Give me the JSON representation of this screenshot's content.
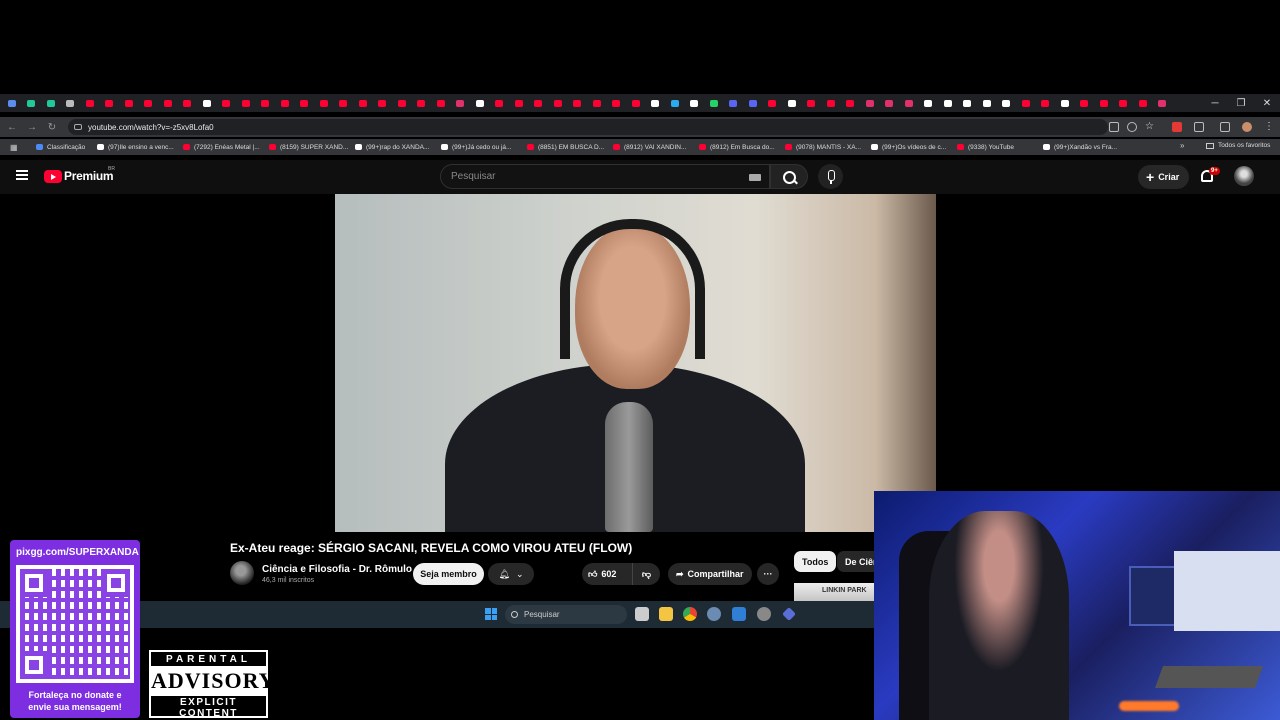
{
  "browser": {
    "url": "youtube.com/watch?v=-z5xv8Lofa0",
    "all_bookmarks_label": "Todos os favoritos",
    "bookmarks": [
      {
        "label": "Classificação",
        "color": "#4c8bf5"
      },
      {
        "label": "(97)Ile ensino a venc...",
        "color": "#ffffff"
      },
      {
        "label": "(7292) Enéas Metal |...",
        "color": "#ff0033"
      },
      {
        "label": "(8159) SUPER XAND...",
        "color": "#ff0033"
      },
      {
        "label": "(99+)rap do XANDÃ...",
        "color": "#ffffff"
      },
      {
        "label": "(99+)Já cedo ou já...",
        "color": "#ffffff"
      },
      {
        "label": "(8851) EM BUSCA D...",
        "color": "#ff0033"
      },
      {
        "label": "(8912) VAI XANDIN...",
        "color": "#ff0033"
      },
      {
        "label": "(8912) Em Busca do...",
        "color": "#ff0033"
      },
      {
        "label": "(9078) MANTIS - XA...",
        "color": "#ff0033"
      },
      {
        "label": "(99+)Os vídeos de c...",
        "color": "#ffffff"
      },
      {
        "label": "(9338) YouTube",
        "color": "#ff0033"
      },
      {
        "label": "(99+)Xandão vs Fra...",
        "color": "#ffffff"
      }
    ],
    "tab_colors": [
      "#5b8def",
      "#20c997",
      "#20c997",
      "#bbbbbb",
      "#ff0033",
      "#ff0033",
      "#ff0033",
      "#ff0033",
      "#ff0033",
      "#ff0033",
      "#ffffff",
      "#ff0033",
      "#ff0033",
      "#ff0033",
      "#ff0033",
      "#ff0033",
      "#ff0033",
      "#ff0033",
      "#ff0033",
      "#ff0033",
      "#ff0033",
      "#ff0033",
      "#ff0033",
      "#e1306c",
      "#ffffff",
      "#ff0033",
      "#ff0033",
      "#ff0033",
      "#ff0033",
      "#ff0033",
      "#ff0033",
      "#ff0033",
      "#ff0033",
      "#ffffff",
      "#2aabee",
      "#ffffff",
      "#25d366",
      "#5865f2",
      "#5865f2",
      "#ff0033",
      "#ffffff",
      "#ff0033",
      "#ff0033",
      "#ff0033",
      "#e1306c",
      "#e1306c",
      "#e1306c",
      "#ffffff",
      "#ffffff",
      "#ffffff",
      "#ffffff",
      "#ffffff",
      "#ff0033",
      "#ff0033",
      "#ffffff",
      "#ff0033",
      "#ff0033",
      "#ff0033",
      "#ff0033",
      "#e1306c"
    ]
  },
  "youtube": {
    "brand": "Premium",
    "country": "BR",
    "search_placeholder": "Pesquisar",
    "create_label": "Criar",
    "notif_badge": "9+",
    "video": {
      "title": "Ex-Ateu reage: SÉRGIO SACANI, REVELA COMO VIROU ATEU (FLOW)",
      "channel": "Ciência e Filosofia - Dr. Rômulo",
      "subscribers": "46,3 mil inscritos",
      "join_label": "Seja membro",
      "likes": "602",
      "share_label": "Compartilhar"
    },
    "chips": [
      "Todos",
      "De Ciên"
    ],
    "related_text": "LINKIN PARK"
  },
  "taskbar": {
    "search_placeholder": "Pesquisar"
  },
  "overlay": {
    "pix_url": "pixgg.com/SUPERXANDA",
    "donate_line1": "Fortaleça no donate e",
    "donate_line2": "envie sua mensagem!",
    "advisory_top": "PARENTAL",
    "advisory_mid": "ADVISORY",
    "advisory_bot": "EXPLICIT CONTENT"
  }
}
